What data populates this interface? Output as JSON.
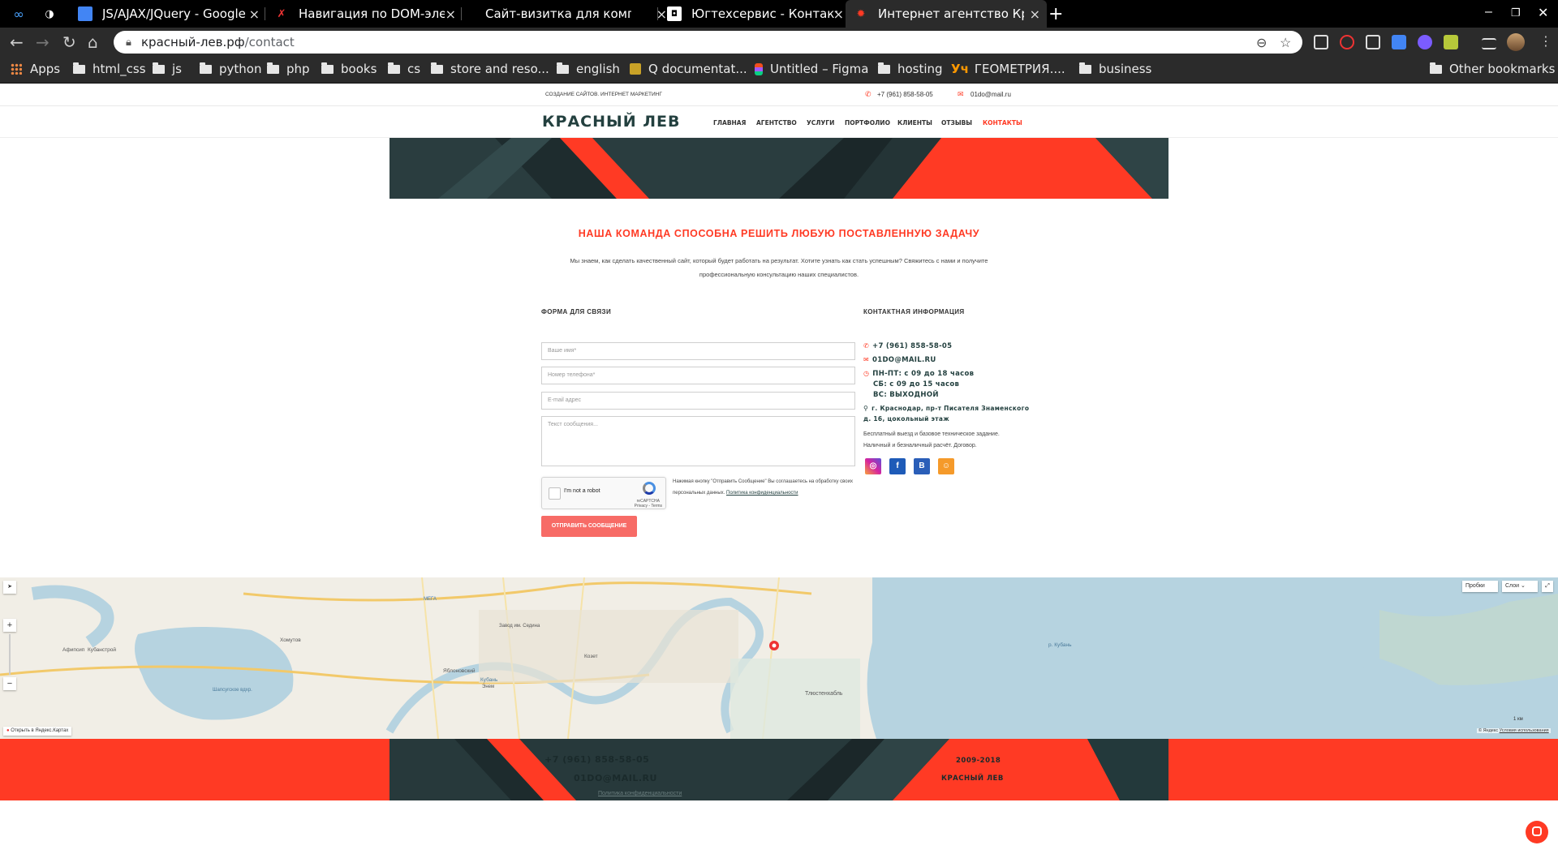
{
  "browser": {
    "tabs": [
      {
        "title": "",
        "favicon": "∞"
      },
      {
        "title": "",
        "favicon": "◑"
      },
      {
        "title": "JS/AJAX/JQuery - Google",
        "favicon": "doc"
      },
      {
        "title": "Навигация по DOM-элем",
        "favicon": "x"
      },
      {
        "title": "Сайт-визитка для компа",
        "favicon": ""
      },
      {
        "title": "Югтехсервис - Контактна",
        "favicon": "yu"
      },
      {
        "title": "Интернет агентство Крас",
        "favicon": "paw"
      }
    ],
    "new_tab": "+",
    "address": {
      "host": "красный-лев.рф",
      "path": "/contact"
    },
    "bookmarks": [
      "Apps",
      "html_css",
      "js",
      "python",
      "php",
      "books",
      "cs",
      "store and reso...",
      "english",
      "Q documentat...",
      "Untitled – Figma",
      "hosting",
      "ГЕОМЕТРИЯ....",
      "business"
    ],
    "other_bookmarks": "Other bookmarks"
  },
  "site": {
    "topbar": {
      "tagline": "СОЗДАНИЕ САЙТОВ. ИНТЕРНЕТ МАРКЕТИНГ",
      "phone": "+7 (961) 858-58-05",
      "email": "01do@mail.ru"
    },
    "logo": "КРАСНЫЙ ЛЕВ",
    "nav": [
      "ГЛАВНАЯ",
      "АГЕНТСТВО",
      "УСЛУГИ",
      "ПОРТФОЛИО",
      "КЛИЕНТЫ",
      "ОТЗЫВЫ",
      "КОНТАКТЫ"
    ],
    "headline": "НАША КОМАНДА СПОСОБНА РЕШИТЬ ЛЮБУЮ ПОСТАВЛЕННУЮ ЗАДАЧУ",
    "intro": "Мы знаем, как сделать качественный сайт, который будет работать на результат. Хотите узнать как стать успешным? Свяжитесь с нами и получите профессиональную консультацию наших специалистов.",
    "form": {
      "title": "ФОРМА ДЛЯ СВЯЗИ",
      "name_placeholder": "Ваше имя*",
      "phone_placeholder": "Номер телефона*",
      "email_placeholder": "E-mail адрес",
      "message_placeholder": "Текст сообщения...",
      "captcha_label": "I'm not a robot",
      "captcha_brand": "reCAPTCHA",
      "captcha_links": "Privacy - Terms",
      "consent_text": "Нажимая кнопку \"Отправить Сообщение\" Вы соглашаетесь на обработку своих персональных данных.",
      "consent_link": "Политика конфиденциальности",
      "submit": "ОТПРАВИТЬ СООБЩЕНИЕ"
    },
    "contacts": {
      "title": "КОНТАКТНАЯ ИНФОРМАЦИЯ",
      "phone": "+7 (961) 858-58-05",
      "email": "01DO@MAIL.RU",
      "hours_1": "ПН-ПТ: с 09 до 18 часов",
      "hours_2": "СБ: с 09 до 15 часов",
      "hours_3": "ВС: ВЫХОДНОЙ",
      "address_1": "г. Краснодар, пр-т Писателя Знаменского",
      "address_2": "д. 16, цокольный этаж",
      "note_1": "Бесплатный выезд и базовое техническое задание.",
      "note_2": "Наличный и безналичный расчёт. Договор.",
      "social": [
        "instagram",
        "f",
        "В",
        "ok"
      ]
    },
    "map": {
      "traffic": "Пробки",
      "layers": "Слои",
      "open_link": "Открыть в Яндекс.Картах",
      "copyright": "© Яндекс",
      "terms": "Условия использования",
      "scale": "1 км",
      "labels": {
        "l1": "Афипсип",
        "l2": "Кубанстрой",
        "l3": "Хомутов",
        "l4": "Шапсугское вдхр.",
        "l5": "Яблоновский",
        "l6": "Козет",
        "l7": "Тлюстенхабль",
        "l8": "р. Кубань",
        "l9": "Кубань",
        "l10": "Завод им. Седина",
        "l11": "Энем",
        "l12": "МЕГА"
      }
    },
    "footer": {
      "phone": "+7 (961) 858-58-05",
      "email": "01DO@MAIL.RU",
      "policy": "Политика конфиденциальности",
      "years": "2009-2018",
      "brand": "КРАСНЫЙ ЛЕВ"
    }
  },
  "colors": {
    "accent": "#ff3a24",
    "dark": "#23403f",
    "banner": "#2a3d3f",
    "button": "#f76b66"
  }
}
